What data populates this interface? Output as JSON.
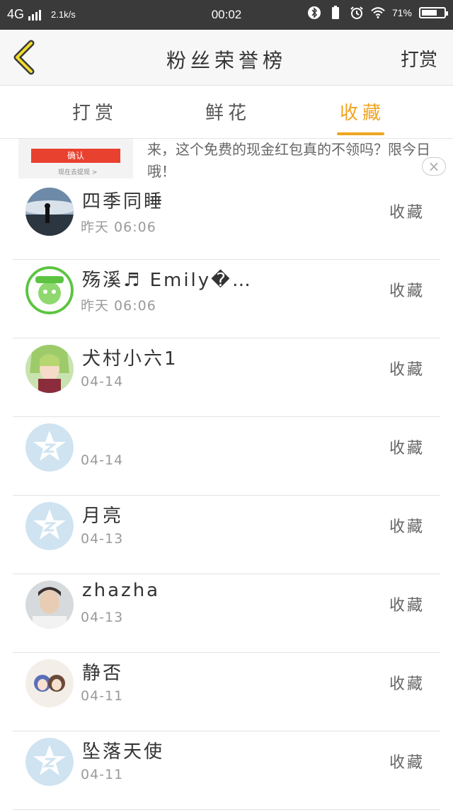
{
  "status_bar": {
    "network": "4G",
    "speed": "2.1k/s",
    "time": "00:02",
    "battery": "71%",
    "battery_level": 0.71
  },
  "nav": {
    "title": "粉丝荣誉榜",
    "right_label": "打赏"
  },
  "tabs": [
    {
      "label": "打赏",
      "active": false
    },
    {
      "label": "鲜花",
      "active": false
    },
    {
      "label": "收藏",
      "active": true
    }
  ],
  "ad": {
    "confirm_label": "确认",
    "sub_label": "现在去提现 >",
    "text": "来，这个免费的现金红包真的不领吗？限今日哦！",
    "close": "×"
  },
  "rows": [
    {
      "name": "四季同睡",
      "time": "昨天 06:06",
      "action": "收藏",
      "avatar": "photo-dusk"
    },
    {
      "name": "殇溪♬ Emily�…",
      "time": "昨天 06:06",
      "action": "收藏",
      "avatar": "cartoon-green"
    },
    {
      "name": "犬村小六1",
      "time": "04-14",
      "action": "收藏",
      "avatar": "anime-girl"
    },
    {
      "name": "",
      "time": "04-14",
      "action": "收藏",
      "avatar": "default-star"
    },
    {
      "name": "月亮",
      "time": "04-13",
      "action": "收藏",
      "avatar": "default-star"
    },
    {
      "name": "zhazha",
      "time": "04-13",
      "action": "收藏",
      "avatar": "photo-boy"
    },
    {
      "name": "静否",
      "time": "04-11",
      "action": "收藏",
      "avatar": "anime-duo"
    },
    {
      "name": "坠落天使",
      "time": "04-11",
      "action": "收藏",
      "avatar": "default-star"
    }
  ],
  "colors": {
    "accent": "#f0a421",
    "status_bar": "#3a3a3a",
    "default_avatar": "#cfe3f1"
  }
}
